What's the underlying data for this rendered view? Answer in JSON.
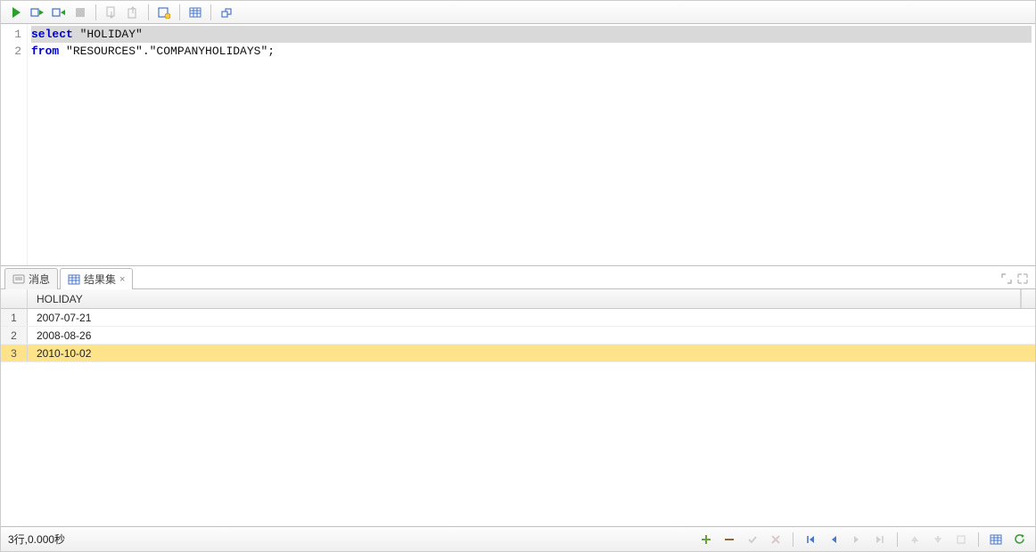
{
  "toolbar": {
    "icons": [
      "run",
      "exec-step",
      "exec-plan",
      "stop-disabled",
      "|",
      "export-sql-disabled",
      "import-sql-disabled",
      "|",
      "sql-hist",
      "|",
      "grid-view",
      "|",
      "pin-result"
    ]
  },
  "editor": {
    "lines": [
      {
        "n": 1,
        "tokens": [
          {
            "t": "select",
            "c": "kw"
          },
          {
            "t": " \"HOLIDAY\"",
            "c": "str"
          }
        ],
        "selected": true
      },
      {
        "n": 2,
        "tokens": [
          {
            "t": "from",
            "c": "kw"
          },
          {
            "t": " \"RESOURCES\".\"COMPANYHOLIDAYS\";",
            "c": "str"
          }
        ],
        "selected": false
      }
    ]
  },
  "tabs": {
    "messages_label": "消息",
    "results_label": "结果集"
  },
  "grid": {
    "column": "HOLIDAY",
    "rows": [
      {
        "n": 1,
        "v": "2007-07-21",
        "sel": false
      },
      {
        "n": 2,
        "v": "2008-08-26",
        "sel": false
      },
      {
        "n": 3,
        "v": "2010-10-02",
        "sel": true
      }
    ]
  },
  "status": {
    "text": "3行,0.000秒"
  }
}
